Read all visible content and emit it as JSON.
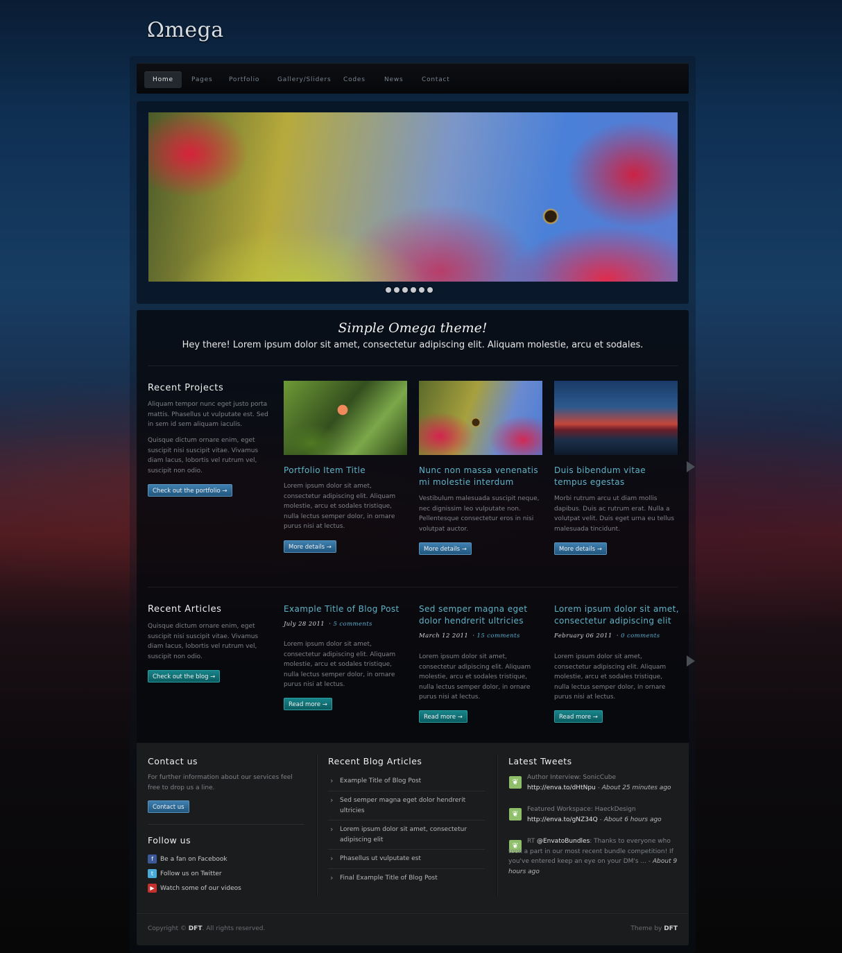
{
  "logo": "Ωmega",
  "nav": [
    "Home",
    "Pages",
    "Portfolio",
    "Gallery/Sliders",
    "Codes",
    "News",
    "Contact"
  ],
  "slider": {
    "dots": 6
  },
  "intro": {
    "title": "Simple Omega theme!",
    "subtitle": "Hey there! Lorem ipsum dolor sit amet, consectetur adipiscing elit. Aliquam molestie, arcu et sodales."
  },
  "projects": {
    "title": "Recent Projects",
    "p1": "Aliquam tempor nunc eget justo porta mattis. Phasellus ut vulputate est. Sed in sem id sem aliquam iaculis.",
    "p2": "Quisque dictum ornare enim, eget suscipit nisi suscipit vitae. Vivamus diam lacus, lobortis vel rutrum vel, suscipit non odio.",
    "button": "Check out the portfolio →",
    "items": [
      {
        "title": "Portfolio Item Title",
        "text": "Lorem ipsum dolor sit amet, consectetur adipiscing elit. Aliquam molestie, arcu et sodales tristique, nulla lectus semper dolor, in ornare purus nisi at lectus.",
        "button": "More details →"
      },
      {
        "title": "Nunc non massa venenatis mi molestie interdum",
        "text": "Vestibulum malesuada suscipit neque, nec dignissim leo vulputate non. Pellentesque consectetur eros in nisi volutpat auctor.",
        "button": "More details →"
      },
      {
        "title": "Duis bibendum vitae tempus egestas",
        "text": "Morbi rutrum arcu ut diam mollis dapibus. Duis ac rutrum erat. Nulla a volutpat velit. Duis eget urna eu tellus malesuada tincidunt.",
        "button": "More details →"
      }
    ]
  },
  "articles": {
    "title": "Recent Articles",
    "p1": "Quisque dictum ornare enim, eget suscipit nisi suscipit vitae. Vivamus diam lacus, lobortis vel rutrum vel, suscipit non odio.",
    "button": "Check out the blog →",
    "items": [
      {
        "title": "Example Title of Blog Post",
        "date": "July 28 2011",
        "comments": "5 comments",
        "text": "Lorem ipsum dolor sit amet, consectetur adipiscing elit. Aliquam molestie, arcu et sodales tristique, nulla lectus semper dolor, in ornare purus nisi at lectus.",
        "button": "Read more →"
      },
      {
        "title": "Sed semper magna eget dolor hendrerit ultricies",
        "date": "March 12 2011",
        "comments": "15 comments",
        "text": "Lorem ipsum dolor sit amet, consectetur adipiscing elit. Aliquam molestie, arcu et sodales tristique, nulla lectus semper dolor, in ornare purus nisi at lectus.",
        "button": "Read more →"
      },
      {
        "title": "Lorem ipsum dolor sit amet, consectetur adipiscing elit",
        "date": "February 06 2011",
        "comments": "0 comments",
        "text": "Lorem ipsum dolor sit amet, consectetur adipiscing elit. Aliquam molestie, arcu et sodales tristique, nulla lectus semper dolor, in ornare purus nisi at lectus.",
        "button": "Read more →"
      }
    ]
  },
  "footer": {
    "contact": {
      "title": "Contact us",
      "text": "For further information about our services feel free to drop us a line.",
      "button": "Contact us"
    },
    "follow": {
      "title": "Follow us",
      "items": [
        "Be a fan on Facebook",
        "Follow us on Twitter",
        "Watch some of our videos"
      ]
    },
    "blog": {
      "title": "Recent Blog Articles",
      "items": [
        "Example Title of Blog Post",
        "Sed semper magna eget dolor hendrerit ultricies",
        "Lorem ipsum dolor sit amet, consectetur adipiscing elit",
        "Phasellus ut vulputate est",
        "Final Example Title of Blog Post"
      ]
    },
    "tweets": {
      "title": "Latest Tweets",
      "items": [
        {
          "text": "Author Interview: SonicCube ",
          "link": "http://enva.to/dHtNpu",
          "time": "About 25 minutes ago"
        },
        {
          "text": "Featured Workspace: HaeckDesign ",
          "link": "http://enva.to/gNZ34Q",
          "time": "About 6 hours ago"
        },
        {
          "prefix": "RT ",
          "handle": "@EnvatoBundles",
          "text": ": Thanks to everyone who took a part in our most recent bundle competition! If you've entered keep an eye on your DM's ... ",
          "time": "About 9 hours ago"
        }
      ]
    },
    "copyright": {
      "text": "Copyright © ",
      "brand": "DFT",
      "rest": ". All rights reserved."
    },
    "theme": {
      "text": "Theme by ",
      "brand": "DFT"
    }
  },
  "colors": {
    "accent_link": "#5fb3c8",
    "button_blue": "#2f6e9c",
    "button_teal": "#0f7276"
  }
}
